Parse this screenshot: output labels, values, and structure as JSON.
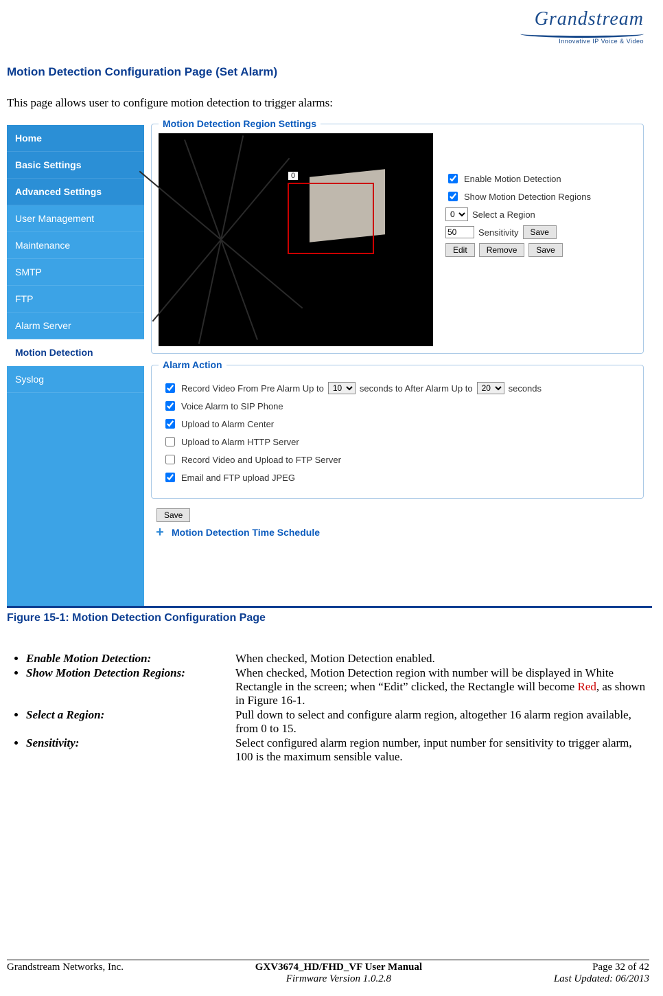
{
  "logo": {
    "name": "Grandstream",
    "tagline": "Innovative IP Voice & Video"
  },
  "section_title": "Motion Detection Configuration Page (Set Alarm)",
  "intro": "This page allows user to configure motion detection to trigger alarms:",
  "sidebar": {
    "items": [
      {
        "label": "Home",
        "kind": "main"
      },
      {
        "label": "Basic Settings",
        "kind": "main"
      },
      {
        "label": "Advanced Settings",
        "kind": "main"
      },
      {
        "label": "User Management",
        "kind": "sub"
      },
      {
        "label": "Maintenance",
        "kind": "sub"
      },
      {
        "label": "SMTP",
        "kind": "sub"
      },
      {
        "label": "FTP",
        "kind": "sub"
      },
      {
        "label": "Alarm Server",
        "kind": "sub"
      },
      {
        "label": "Motion Detection",
        "kind": "active"
      },
      {
        "label": "Syslog",
        "kind": "sub"
      }
    ]
  },
  "region_settings": {
    "legend": "Motion Detection Region Settings",
    "region_label": "0",
    "enable_label": "Enable Motion Detection",
    "show_label": "Show Motion Detection Regions",
    "select_label": "Select a Region",
    "select_value": "0",
    "sens_label": "Sensitivity",
    "sens_value": "50",
    "save_sens": "Save",
    "edit": "Edit",
    "remove": "Remove",
    "save": "Save"
  },
  "alarm_action": {
    "legend": "Alarm Action",
    "row1_a": "Record Video From Pre Alarm  Up to",
    "row1_pre": "10",
    "row1_b": "seconds  to After Alarm  Up to",
    "row1_post": "20",
    "row1_c": "seconds",
    "row2": "Voice Alarm to SIP Phone",
    "row3": "Upload to Alarm Center",
    "row4": "Upload to Alarm HTTP Server",
    "row5": "Record Video and Upload to FTP Server",
    "row6": "Email and FTP upload JPEG",
    "save": "Save"
  },
  "collapse": {
    "title": "Motion Detection Time Schedule"
  },
  "caption": "Figure 15-1:  Motion Detection Configuration Page",
  "bullets": [
    {
      "term": "Enable Motion Detection:",
      "def": "When checked, Motion Detection enabled."
    },
    {
      "term": "Show Motion Detection Regions:",
      "def_pre": "When checked, Motion Detection region with number will be displayed in White Rectangle in the screen; when “Edit” clicked, the Rectangle will become ",
      "def_red": "Red",
      "def_post": ", as shown in Figure 16-1."
    },
    {
      "term": "Select a Region:",
      "def": "Pull down to select and configure alarm region, altogether 16 alarm region available, from 0 to 15."
    },
    {
      "term": "Sensitivity:",
      "def": "Select configured alarm region number, input number for sensitivity to trigger alarm, 100 is the maximum sensible value."
    }
  ],
  "footer": {
    "left": "Grandstream Networks, Inc.",
    "mid_title": "GXV3674_HD/FHD_VF User Manual",
    "mid_fw": "Firmware Version 1.0.2.8",
    "right_page": "Page 32 of 42",
    "right_date": "Last Updated: 06/2013"
  }
}
